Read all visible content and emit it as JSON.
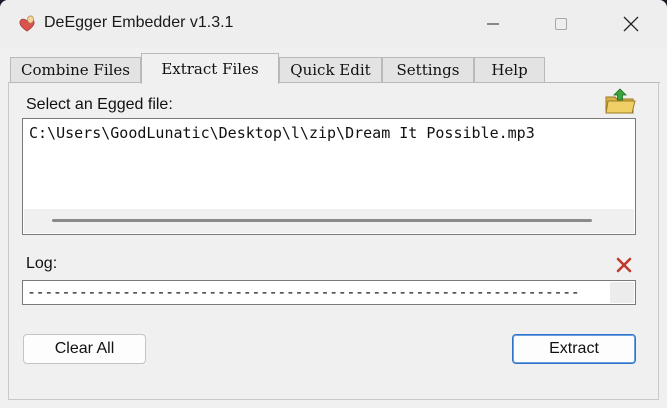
{
  "window": {
    "title": "DeEgger Embedder v1.3.1",
    "app_icon": "egg-heart-icon",
    "controls": [
      "minimize-icon",
      "maximize-icon",
      "close-icon"
    ]
  },
  "tabs": [
    {
      "label": "Combine Files",
      "active": false
    },
    {
      "label": "Extract Files",
      "active": true
    },
    {
      "label": "Quick Edit",
      "active": false
    },
    {
      "label": "Settings",
      "active": false
    },
    {
      "label": "Help",
      "active": false
    }
  ],
  "extract": {
    "select_label": "Select an Egged file:",
    "browse_icon": "open-folder-icon",
    "file_path": "C:\\Users\\GoodLunatic\\Desktop\\l\\zip\\Dream It Possible.mp3",
    "log_label": "Log:",
    "clear_log_icon": "red-x-icon",
    "log_text": "----------------------------------------------------------------",
    "clear_all_label": "Clear All",
    "extract_label": "Extract"
  },
  "colors": {
    "window_bg": "#f0f0f0",
    "accent_border": "#2f73c9",
    "clear_x": "#c0392b"
  }
}
